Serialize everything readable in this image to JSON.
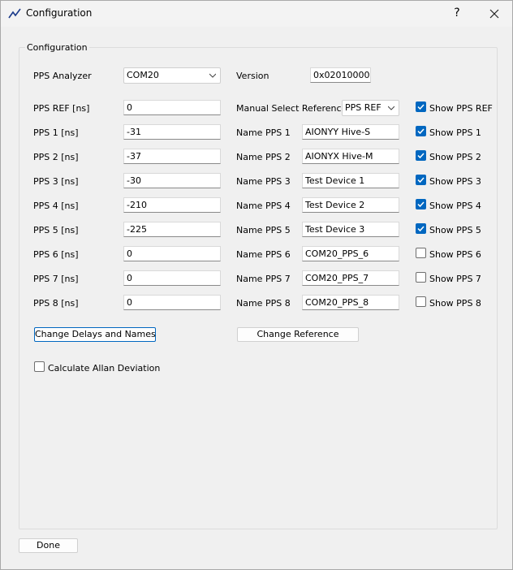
{
  "window": {
    "title": "Configuration",
    "help": "?"
  },
  "group": {
    "title": "Configuration"
  },
  "analyzer": {
    "label": "PPS Analyzer",
    "value": "COM20"
  },
  "version": {
    "label": "Version",
    "value": "0x02010000"
  },
  "reference": {
    "label": "Manual Select Reference",
    "value": "PPS REF"
  },
  "ref_row": {
    "label": "PPS REF [ns]",
    "delay": "0",
    "show_label": "Show PPS REF",
    "show_checked": true
  },
  "rows": [
    {
      "label": "PPS 1 [ns]",
      "delay": "-31",
      "name_label": "Name PPS 1",
      "name": "AIONYY Hive-S",
      "show_label": "Show PPS 1",
      "show_checked": true
    },
    {
      "label": "PPS 2 [ns]",
      "delay": "-37",
      "name_label": "Name PPS 2",
      "name": "AIONYX Hive-M",
      "show_label": "Show PPS 2",
      "show_checked": true
    },
    {
      "label": "PPS 3 [ns]",
      "delay": "-30",
      "name_label": "Name PPS 3",
      "name": "Test Device 1",
      "show_label": "Show PPS 3",
      "show_checked": true
    },
    {
      "label": "PPS 4 [ns]",
      "delay": "-210",
      "name_label": "Name PPS 4",
      "name": "Test Device 2",
      "show_label": "Show PPS 4",
      "show_checked": true
    },
    {
      "label": "PPS 5 [ns]",
      "delay": "-225",
      "name_label": "Name PPS 5",
      "name": "Test Device 3",
      "show_label": "Show PPS 5",
      "show_checked": true
    },
    {
      "label": "PPS 6 [ns]",
      "delay": "0",
      "name_label": "Name PPS 6",
      "name": "COM20_PPS_6",
      "show_label": "Show PPS 6",
      "show_checked": false
    },
    {
      "label": "PPS 7 [ns]",
      "delay": "0",
      "name_label": "Name PPS 7",
      "name": "COM20_PPS_7",
      "show_label": "Show PPS 7",
      "show_checked": false
    },
    {
      "label": "PPS 8 [ns]",
      "delay": "0",
      "name_label": "Name PPS 8",
      "name": "COM20_PPS_8",
      "show_label": "Show PPS 8",
      "show_checked": false
    }
  ],
  "buttons": {
    "change_delays": "Change Delays and Names",
    "change_reference": "Change Reference",
    "done": "Done"
  },
  "allan": {
    "label": "Calculate Allan Deviation",
    "checked": false
  },
  "colors": {
    "accent": "#0067c0",
    "window_bg": "#f0f0f0"
  }
}
